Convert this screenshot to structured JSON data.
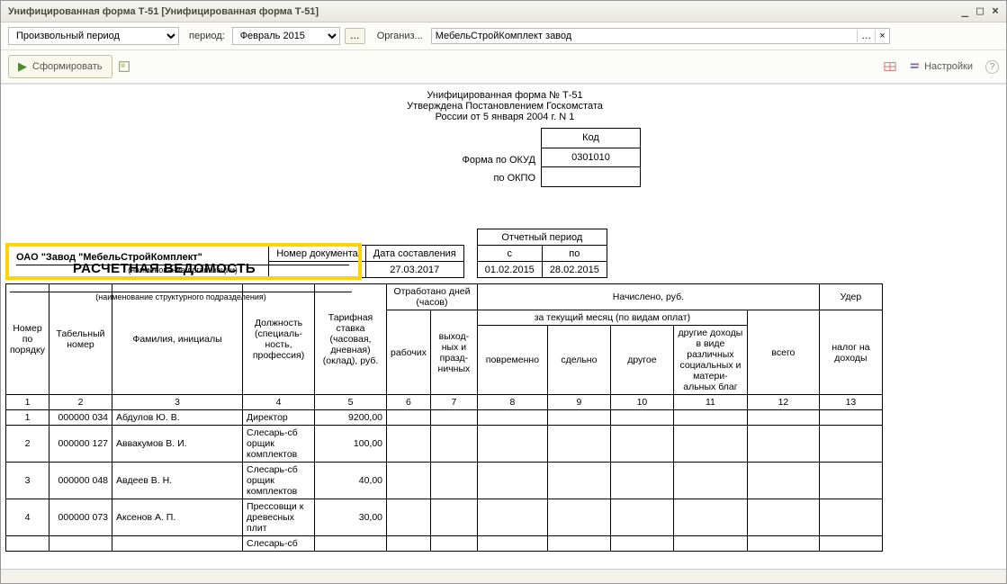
{
  "window": {
    "title": "Унифицированная форма Т-51 [Унифицированная форма Т-51]"
  },
  "toolbar": {
    "period_type": "Произвольный период",
    "period_label": "период:",
    "month": "Февраль 2015",
    "org_label": "Организ...",
    "org_value": "МебельСтройКомплект завод",
    "form_button": "Сформировать",
    "settings_link": "Настройки"
  },
  "header": {
    "line1": "Унифицированная форма № Т-51",
    "line2": "Утверждена Постановлением Госкомстата",
    "line3": "России от 5 января 2004 г. N 1",
    "kod_label": "Код",
    "form_okud_label": "Форма по ОКУД",
    "okud_code": "0301010",
    "okpo_label": "по ОКПО",
    "okpo_code": ""
  },
  "org": {
    "name": "ОАО \"Завод \"МебельСтройКомплект\"",
    "sub": "(наименование организации)",
    "struct_sub": "(наименование структурного подразделения)"
  },
  "doc": {
    "title": "РАСЧЕТНАЯ ВЕДОМОСТЬ",
    "doc_no_label": "Номер документа",
    "doc_no": "",
    "date_label": "Дата составления",
    "date": "27.03.2017",
    "rep_period_label": "Отчетный период",
    "from_label": "с",
    "to_label": "по",
    "from": "01.02.2015",
    "to": "28.02.2015"
  },
  "columns": {
    "c1": "Номер по порядку",
    "c2": "Табельный номер",
    "c3": "Фамилия, инициалы",
    "c4": "Должность (специаль- ность, профессия)",
    "c5": "Тарифная ставка (часовая, дневная) (оклад), руб.",
    "g_days": "Отработано дней (часов)",
    "c6": "рабочих",
    "c7": "выход- ных и празд- ничных",
    "g_accr": "Начислено, руб.",
    "g_month": "за текущий месяц (по видам оплат)",
    "c8": "повременно",
    "c9": "сдельно",
    "c10": "другое",
    "c11": "другие доходы в виде различных социальных и матери- альных благ",
    "c12": "всего",
    "g_uder": "Удер",
    "c13": "налог на доходы"
  },
  "rows": [
    {
      "n": "1",
      "tab": "000000 034",
      "fio": "Абдулов Ю. В.",
      "pos": "Директор",
      "rate": "9200,00"
    },
    {
      "n": "2",
      "tab": "000000 127",
      "fio": "Аввакумов В. И.",
      "pos": "Слесарь-сб орщик комплектов",
      "rate": "100,00"
    },
    {
      "n": "3",
      "tab": "000000 048",
      "fio": "Авдеев В. Н.",
      "pos": "Слесарь-сб орщик комплектов",
      "rate": "40,00"
    },
    {
      "n": "4",
      "tab": "000000 073",
      "fio": "Аксенов А. П.",
      "pos": "Прессовщи к древесных плит",
      "rate": "30,00"
    },
    {
      "n": "",
      "tab": "",
      "fio": "",
      "pos": "Слесарь-сб",
      "rate": ""
    }
  ]
}
